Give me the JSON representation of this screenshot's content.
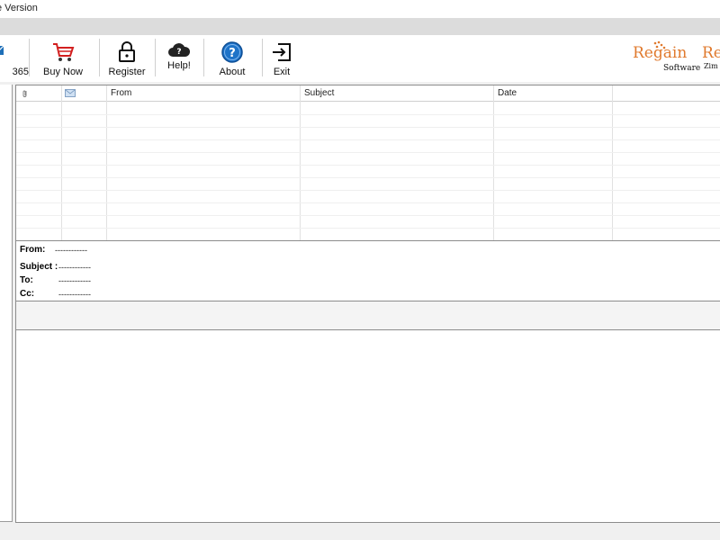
{
  "window": {
    "title": "e Version"
  },
  "toolbar": {
    "office365_label": "365",
    "buy_now_label": "Buy Now",
    "register_label": "Register",
    "help_label": "Help!",
    "about_label": "About",
    "exit_label": "Exit"
  },
  "logos": {
    "regain_name": "Regain",
    "regain_sub": "Software",
    "partial_name": "Re",
    "partial_sub": "Zim"
  },
  "grid": {
    "columns": [
      "",
      "",
      "From",
      "Subject",
      "Date"
    ],
    "attachment_icon": "paperclip-icon",
    "envelope_icon": "envelope-icon"
  },
  "preview": {
    "from_label": "From:",
    "from_value": "------------",
    "subject_label": "Subject :",
    "subject_value": "------------",
    "to_label": "To:",
    "to_value": "------------",
    "cc_label": "Cc:",
    "cc_value": "------------"
  },
  "colors": {
    "brand_orange": "#e07a2e",
    "help_blue": "#1e73c8",
    "cart_red": "#d21f1f"
  }
}
